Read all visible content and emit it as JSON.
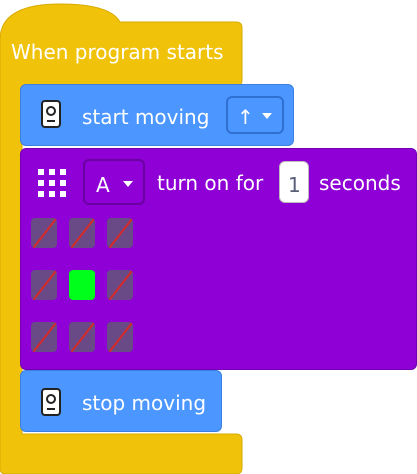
{
  "hat_block": {
    "label": "When program starts",
    "color": "#f0c20a"
  },
  "start_block": {
    "label": "start moving",
    "direction_symbol": "↑",
    "color": "#4c97ff",
    "icon": "motor-hub-icon"
  },
  "light_block": {
    "port": "A",
    "label_before": "turn on for",
    "duration": "1",
    "label_after": "seconds",
    "color": "#8e00d6",
    "icon": "light-matrix-icon",
    "pixels": [
      [
        false,
        false,
        false
      ],
      [
        false,
        true,
        false
      ],
      [
        false,
        false,
        false
      ]
    ]
  },
  "stop_block": {
    "label": "stop moving",
    "color": "#4c97ff",
    "icon": "motor-hub-icon"
  }
}
